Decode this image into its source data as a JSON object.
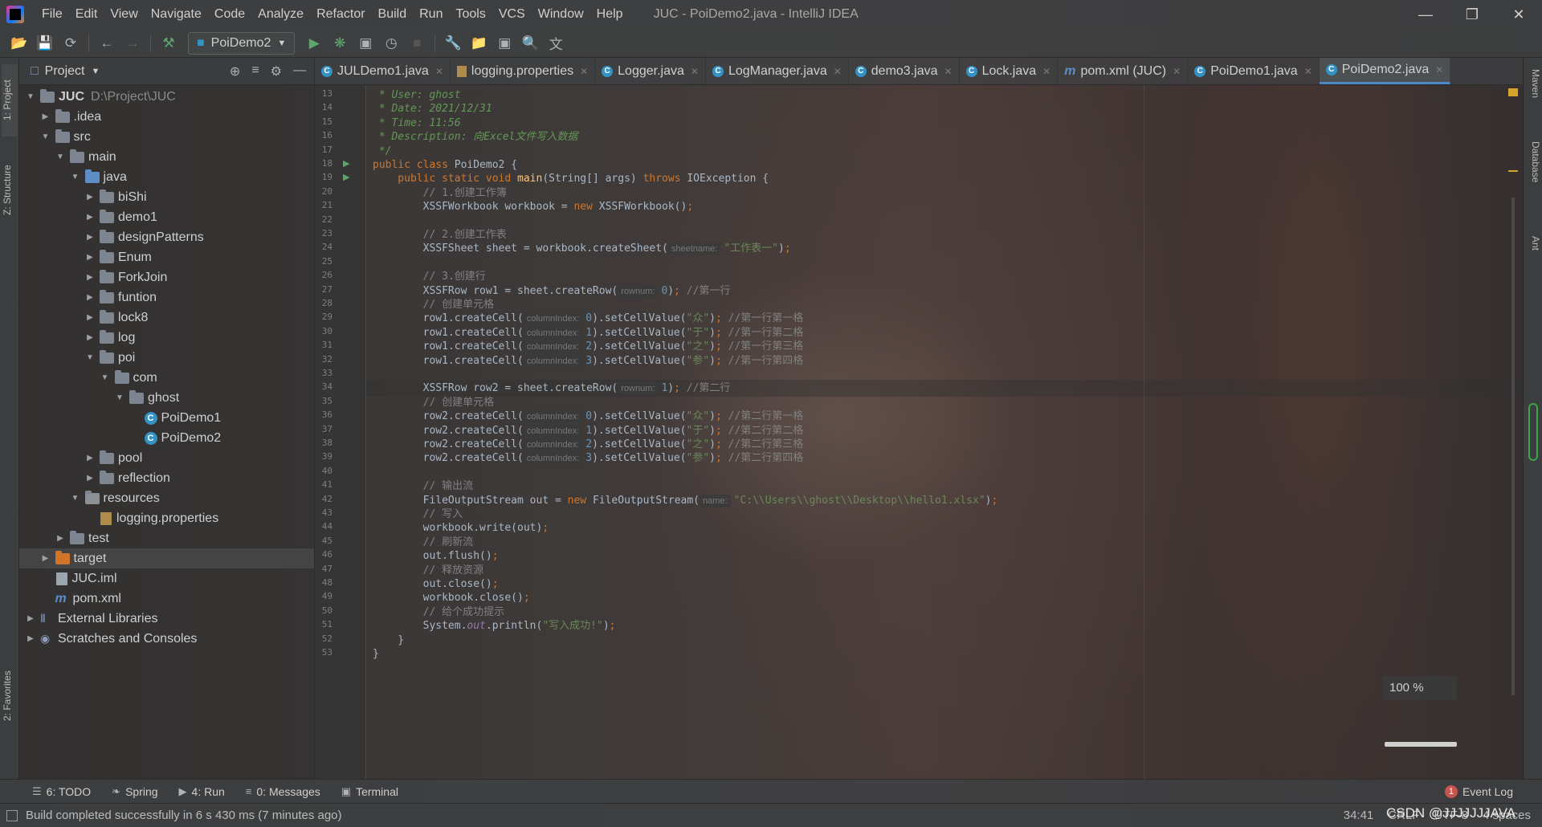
{
  "app": {
    "window_title": "JUC - PoiDemo2.java - IntelliJ IDEA",
    "menu": [
      "File",
      "Edit",
      "View",
      "Navigate",
      "Code",
      "Analyze",
      "Refactor",
      "Build",
      "Run",
      "Tools",
      "VCS",
      "Window",
      "Help"
    ]
  },
  "toolbar": {
    "run_config": "PoiDemo2"
  },
  "side_tabs": {
    "left_top": "1: Project",
    "left_mid": "Z: Structure",
    "left_bottom": "2: Favorites",
    "right": [
      "Maven",
      "Database",
      "Ant"
    ]
  },
  "project_panel": {
    "title": "Project",
    "tree": [
      {
        "label": "JUC",
        "extra": "D:\\Project\\JUC",
        "depth": 0,
        "arrow": "down",
        "icon": "module-folder"
      },
      {
        "label": ".idea",
        "depth": 1,
        "arrow": "right",
        "icon": "folder"
      },
      {
        "label": "src",
        "depth": 1,
        "arrow": "down",
        "icon": "folder"
      },
      {
        "label": "main",
        "depth": 2,
        "arrow": "down",
        "icon": "folder"
      },
      {
        "label": "java",
        "depth": 3,
        "arrow": "down",
        "icon": "source-folder"
      },
      {
        "label": "biShi",
        "depth": 4,
        "arrow": "right",
        "icon": "package"
      },
      {
        "label": "demo1",
        "depth": 4,
        "arrow": "right",
        "icon": "package"
      },
      {
        "label": "designPatterns",
        "depth": 4,
        "arrow": "right",
        "icon": "package"
      },
      {
        "label": "Enum",
        "depth": 4,
        "arrow": "right",
        "icon": "package"
      },
      {
        "label": "ForkJoin",
        "depth": 4,
        "arrow": "right",
        "icon": "package"
      },
      {
        "label": "funtion",
        "depth": 4,
        "arrow": "right",
        "icon": "package"
      },
      {
        "label": "lock8",
        "depth": 4,
        "arrow": "right",
        "icon": "package"
      },
      {
        "label": "log",
        "depth": 4,
        "arrow": "right",
        "icon": "package"
      },
      {
        "label": "poi",
        "depth": 4,
        "arrow": "down",
        "icon": "package"
      },
      {
        "label": "com",
        "depth": 5,
        "arrow": "down",
        "icon": "package"
      },
      {
        "label": "ghost",
        "depth": 6,
        "arrow": "down",
        "icon": "package"
      },
      {
        "label": "PoiDemo1",
        "depth": 7,
        "arrow": "",
        "icon": "class"
      },
      {
        "label": "PoiDemo2",
        "depth": 7,
        "arrow": "",
        "icon": "class"
      },
      {
        "label": "pool",
        "depth": 4,
        "arrow": "right",
        "icon": "package"
      },
      {
        "label": "reflection",
        "depth": 4,
        "arrow": "right",
        "icon": "package"
      },
      {
        "label": "resources",
        "depth": 3,
        "arrow": "down",
        "icon": "resources-folder"
      },
      {
        "label": "logging.properties",
        "depth": 4,
        "arrow": "",
        "icon": "properties"
      },
      {
        "label": "test",
        "depth": 2,
        "arrow": "right",
        "icon": "folder"
      },
      {
        "label": "target",
        "depth": 1,
        "arrow": "right",
        "icon": "excluded-folder",
        "selected": true
      },
      {
        "label": "JUC.iml",
        "depth": 1,
        "arrow": "",
        "icon": "iml"
      },
      {
        "label": "pom.xml",
        "depth": 1,
        "arrow": "",
        "icon": "maven"
      },
      {
        "label": "External Libraries",
        "depth": 0,
        "arrow": "right",
        "icon": "library"
      },
      {
        "label": "Scratches and Consoles",
        "depth": 0,
        "arrow": "right",
        "icon": "scratches"
      }
    ]
  },
  "tabs": [
    {
      "label": "JULDemo1.java",
      "icon": "class"
    },
    {
      "label": "logging.properties",
      "icon": "properties"
    },
    {
      "label": "Logger.java",
      "icon": "class"
    },
    {
      "label": "LogManager.java",
      "icon": "class"
    },
    {
      "label": "demo3.java",
      "icon": "class"
    },
    {
      "label": "Lock.java",
      "icon": "class"
    },
    {
      "label": "pom.xml (JUC)",
      "icon": "maven"
    },
    {
      "label": "PoiDemo1.java",
      "icon": "class"
    },
    {
      "label": "PoiDemo2.java",
      "icon": "class",
      "active": true
    }
  ],
  "editor": {
    "first_line": 13,
    "caret_line": 34,
    "lines": [
      [
        {
          "t": " * User: ghost",
          "c": "doc"
        }
      ],
      [
        {
          "t": " * Date: 2021/12/31",
          "c": "doc"
        }
      ],
      [
        {
          "t": " * Time: 11:56",
          "c": "doc"
        }
      ],
      [
        {
          "t": " * Description: 向Excel文件写入数据",
          "c": "doc"
        }
      ],
      [
        {
          "t": " */",
          "c": "doc"
        }
      ],
      [
        {
          "t": "public class ",
          "c": "k"
        },
        {
          "t": "PoiDemo2 {",
          "c": ""
        }
      ],
      [
        {
          "t": "    public static void ",
          "c": "k"
        },
        {
          "t": "main",
          "c": "fn"
        },
        {
          "t": "(String[] args) ",
          "c": ""
        },
        {
          "t": "throws ",
          "c": "k"
        },
        {
          "t": "IOException {",
          "c": ""
        }
      ],
      [
        {
          "t": "        // 1.创建工作簿",
          "c": "cmt"
        }
      ],
      [
        {
          "t": "        XSSFWorkbook workbook = ",
          "c": ""
        },
        {
          "t": "new ",
          "c": "k"
        },
        {
          "t": "XSSFWorkbook()",
          "c": ""
        },
        {
          "t": ";",
          "c": "k"
        }
      ],
      [],
      [
        {
          "t": "        // 2.创建工作表",
          "c": "cmt"
        }
      ],
      [
        {
          "t": "        XSSFSheet sheet = workbook.createSheet(",
          "c": ""
        },
        {
          "t": "sheetname:",
          "c": "hint"
        },
        {
          "t": "\"工作表一\"",
          "c": "str"
        },
        {
          "t": ")",
          "c": ""
        },
        {
          "t": ";",
          "c": "k"
        }
      ],
      [],
      [
        {
          "t": "        // 3.创建行",
          "c": "cmt"
        }
      ],
      [
        {
          "t": "        XSSFRow row1 = sheet.createRow(",
          "c": ""
        },
        {
          "t": "rownum:",
          "c": "hint"
        },
        {
          "t": "0",
          "c": "num"
        },
        {
          "t": ")",
          "c": ""
        },
        {
          "t": "; ",
          "c": "k"
        },
        {
          "t": "//第一行",
          "c": "cmt"
        }
      ],
      [
        {
          "t": "        // 创建单元格",
          "c": "cmt"
        }
      ],
      [
        {
          "t": "        row1.createCell(",
          "c": ""
        },
        {
          "t": "columnIndex:",
          "c": "hint"
        },
        {
          "t": "0",
          "c": "num"
        },
        {
          "t": ").setCellValue(",
          "c": ""
        },
        {
          "t": "\"众\"",
          "c": "str"
        },
        {
          "t": ")",
          "c": ""
        },
        {
          "t": "; ",
          "c": "k"
        },
        {
          "t": "//第一行第一格",
          "c": "cmt"
        }
      ],
      [
        {
          "t": "        row1.createCell(",
          "c": ""
        },
        {
          "t": "columnIndex:",
          "c": "hint"
        },
        {
          "t": "1",
          "c": "num"
        },
        {
          "t": ").setCellValue(",
          "c": ""
        },
        {
          "t": "\"于\"",
          "c": "str"
        },
        {
          "t": ")",
          "c": ""
        },
        {
          "t": "; ",
          "c": "k"
        },
        {
          "t": "//第一行第二格",
          "c": "cmt"
        }
      ],
      [
        {
          "t": "        row1.createCell(",
          "c": ""
        },
        {
          "t": "columnIndex:",
          "c": "hint"
        },
        {
          "t": "2",
          "c": "num"
        },
        {
          "t": ").setCellValue(",
          "c": ""
        },
        {
          "t": "\"之\"",
          "c": "str"
        },
        {
          "t": ")",
          "c": ""
        },
        {
          "t": "; ",
          "c": "k"
        },
        {
          "t": "//第一行第三格",
          "c": "cmt"
        }
      ],
      [
        {
          "t": "        row1.createCell(",
          "c": ""
        },
        {
          "t": "columnIndex:",
          "c": "hint"
        },
        {
          "t": "3",
          "c": "num"
        },
        {
          "t": ").setCellValue(",
          "c": ""
        },
        {
          "t": "\"参\"",
          "c": "str"
        },
        {
          "t": ")",
          "c": ""
        },
        {
          "t": "; ",
          "c": "k"
        },
        {
          "t": "//第一行第四格",
          "c": "cmt"
        }
      ],
      [],
      [
        {
          "t": "        XSSFRow row2 = sheet.createRow(",
          "c": ""
        },
        {
          "t": "rownum:",
          "c": "hint"
        },
        {
          "t": "1",
          "c": "num"
        },
        {
          "t": ")",
          "c": ""
        },
        {
          "t": "; ",
          "c": "k"
        },
        {
          "t": "//第二行",
          "c": "cmt"
        }
      ],
      [
        {
          "t": "        // 创建单元格",
          "c": "cmt"
        }
      ],
      [
        {
          "t": "        row2.createCell(",
          "c": ""
        },
        {
          "t": "columnIndex:",
          "c": "hint"
        },
        {
          "t": "0",
          "c": "num"
        },
        {
          "t": ").setCellValue(",
          "c": ""
        },
        {
          "t": "\"众\"",
          "c": "str"
        },
        {
          "t": ")",
          "c": ""
        },
        {
          "t": "; ",
          "c": "k"
        },
        {
          "t": "//第二行第一格",
          "c": "cmt"
        }
      ],
      [
        {
          "t": "        row2.createCell(",
          "c": ""
        },
        {
          "t": "columnIndex:",
          "c": "hint"
        },
        {
          "t": "1",
          "c": "num"
        },
        {
          "t": ").setCellValue(",
          "c": ""
        },
        {
          "t": "\"于\"",
          "c": "str"
        },
        {
          "t": ")",
          "c": ""
        },
        {
          "t": "; ",
          "c": "k"
        },
        {
          "t": "//第二行第二格",
          "c": "cmt"
        }
      ],
      [
        {
          "t": "        row2.createCell(",
          "c": ""
        },
        {
          "t": "columnIndex:",
          "c": "hint"
        },
        {
          "t": "2",
          "c": "num"
        },
        {
          "t": ").setCellValue(",
          "c": ""
        },
        {
          "t": "\"之\"",
          "c": "str"
        },
        {
          "t": ")",
          "c": ""
        },
        {
          "t": "; ",
          "c": "k"
        },
        {
          "t": "//第二行第三格",
          "c": "cmt"
        }
      ],
      [
        {
          "t": "        row2.createCell(",
          "c": ""
        },
        {
          "t": "columnIndex:",
          "c": "hint"
        },
        {
          "t": "3",
          "c": "num"
        },
        {
          "t": ").setCellValue(",
          "c": ""
        },
        {
          "t": "\"参\"",
          "c": "str"
        },
        {
          "t": ")",
          "c": ""
        },
        {
          "t": "; ",
          "c": "k"
        },
        {
          "t": "//第二行第四格",
          "c": "cmt"
        }
      ],
      [],
      [
        {
          "t": "        // 输出流",
          "c": "cmt"
        }
      ],
      [
        {
          "t": "        FileOutputStream out = ",
          "c": ""
        },
        {
          "t": "new ",
          "c": "k"
        },
        {
          "t": "FileOutputStream(",
          "c": ""
        },
        {
          "t": "name:",
          "c": "hint"
        },
        {
          "t": "\"C:\\\\Users\\\\ghost\\\\Desktop\\\\hello1.xlsx\"",
          "c": "str"
        },
        {
          "t": ")",
          "c": ""
        },
        {
          "t": ";",
          "c": "k"
        }
      ],
      [
        {
          "t": "        // 写入",
          "c": "cmt"
        }
      ],
      [
        {
          "t": "        workbook.write(out)",
          "c": ""
        },
        {
          "t": ";",
          "c": "k"
        }
      ],
      [
        {
          "t": "        // 刷新流",
          "c": "cmt"
        }
      ],
      [
        {
          "t": "        out.flush()",
          "c": ""
        },
        {
          "t": ";",
          "c": "k"
        }
      ],
      [
        {
          "t": "        // 释放资源",
          "c": "cmt"
        }
      ],
      [
        {
          "t": "        out.close()",
          "c": ""
        },
        {
          "t": ";",
          "c": "k"
        }
      ],
      [
        {
          "t": "        workbook.close()",
          "c": ""
        },
        {
          "t": ";",
          "c": "k"
        }
      ],
      [
        {
          "t": "        // 给个成功提示",
          "c": "cmt"
        }
      ],
      [
        {
          "t": "        System.",
          "c": ""
        },
        {
          "t": "out",
          "c": "static-i"
        },
        {
          "t": ".println(",
          "c": ""
        },
        {
          "t": "\"写入成功!\"",
          "c": "str"
        },
        {
          "t": ")",
          "c": ""
        },
        {
          "t": ";",
          "c": "k"
        }
      ],
      [
        {
          "t": "    }",
          "c": ""
        }
      ],
      [
        {
          "t": "}",
          "c": ""
        }
      ]
    ],
    "run_gutter_lines": [
      18,
      19
    ],
    "zoom": "100 %"
  },
  "bottom_tools": [
    {
      "label": "6: TODO",
      "icon": "list-icon"
    },
    {
      "label": "Spring",
      "icon": "spring-icon"
    },
    {
      "label": "4: Run",
      "icon": "run-icon"
    },
    {
      "label": "0: Messages",
      "icon": "messages-icon"
    },
    {
      "label": "Terminal",
      "icon": "terminal-icon"
    }
  ],
  "event_log": {
    "label": "Event Log",
    "count": "1"
  },
  "status": {
    "message": "Build completed successfully in 6 s 430 ms (7 minutes ago)",
    "position": "34:41",
    "line_sep": "CRLF",
    "encoding": "UTF-8",
    "indent": "4 spaces",
    "watermark": "CSDN @JJJJJJJAVA"
  }
}
